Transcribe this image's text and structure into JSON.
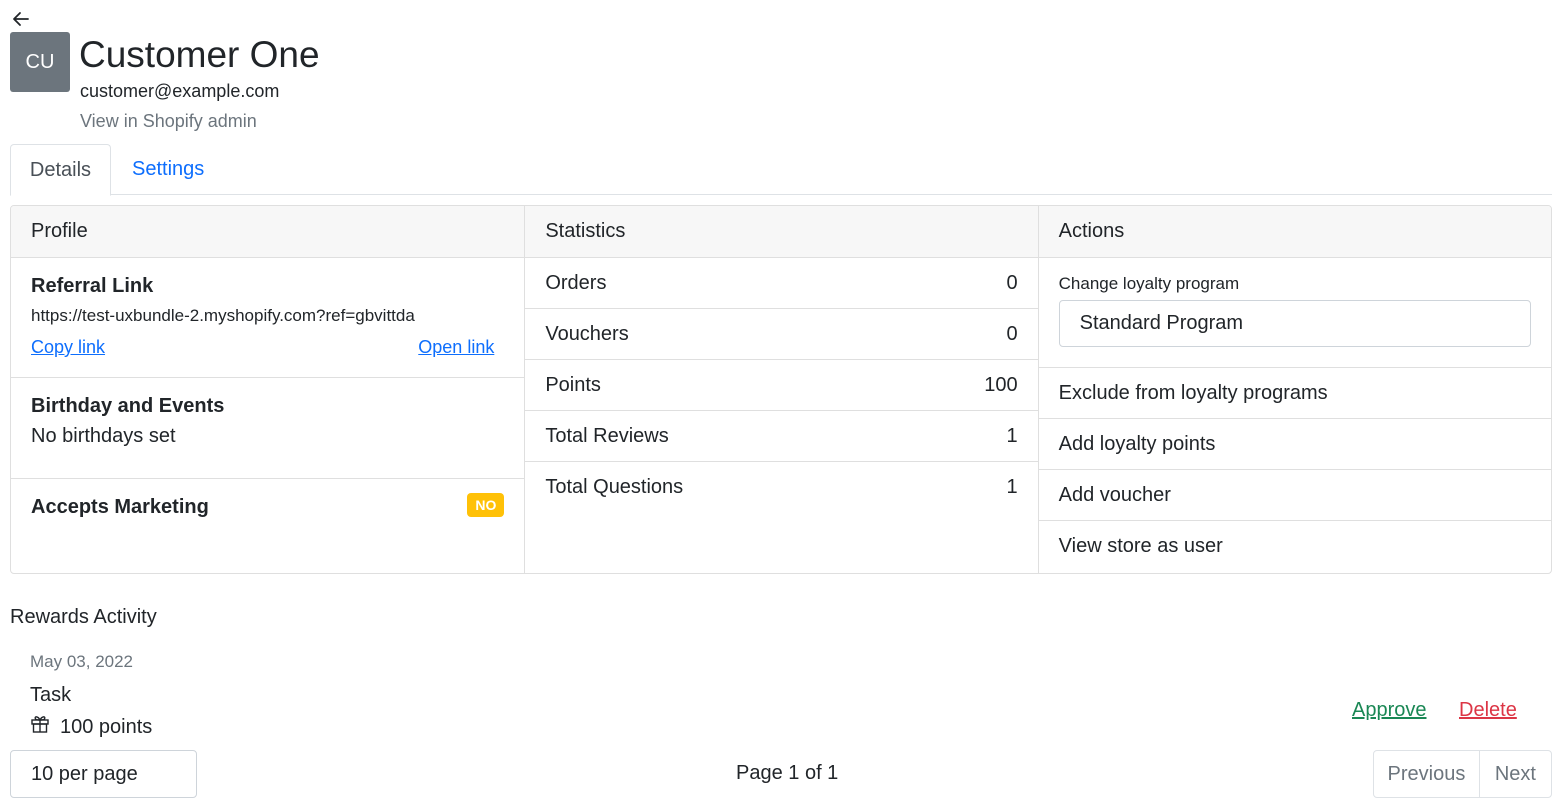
{
  "header": {
    "back_icon": "arrow-left-icon",
    "avatar_initials": "CU",
    "name": "Customer One",
    "email": "customer@example.com",
    "admin_link": "View in Shopify admin"
  },
  "tabs": [
    {
      "label": "Details",
      "active": true
    },
    {
      "label": "Settings",
      "active": false
    }
  ],
  "profile": {
    "title": "Profile",
    "referral": {
      "title": "Referral Link",
      "url": "https://test-uxbundle-2.myshopify.com?ref=gbvittda",
      "copy": "Copy link",
      "open": "Open link"
    },
    "birthday": {
      "title": "Birthday and Events",
      "text": "No birthdays set"
    },
    "marketing": {
      "title": "Accepts Marketing",
      "badge": "NO"
    }
  },
  "statistics": {
    "title": "Statistics",
    "rows": [
      {
        "label": "Orders",
        "value": "0"
      },
      {
        "label": "Vouchers",
        "value": "0"
      },
      {
        "label": "Points",
        "value": "100"
      },
      {
        "label": "Total Reviews",
        "value": "1"
      },
      {
        "label": "Total Questions",
        "value": "1"
      }
    ]
  },
  "actions": {
    "title": "Actions",
    "program_label": "Change loyalty program",
    "program_value": "Standard Program",
    "items": [
      "Exclude from loyalty programs",
      "Add loyalty points",
      "Add voucher",
      "View store as user"
    ]
  },
  "rewards": {
    "title": "Rewards Activity",
    "entry": {
      "date": "May 03, 2022",
      "type": "Task",
      "points": "100 points",
      "icon": "gift-icon",
      "approve": "Approve",
      "delete": "Delete"
    }
  },
  "pagination": {
    "per_page": "10 per page",
    "info": "Page 1 of 1",
    "prev": "Previous",
    "next": "Next"
  },
  "colors": {
    "link": "#0d6efd",
    "approve": "#198754",
    "delete": "#dc3545",
    "badge": "#ffc107",
    "avatar": "#6c757d"
  }
}
